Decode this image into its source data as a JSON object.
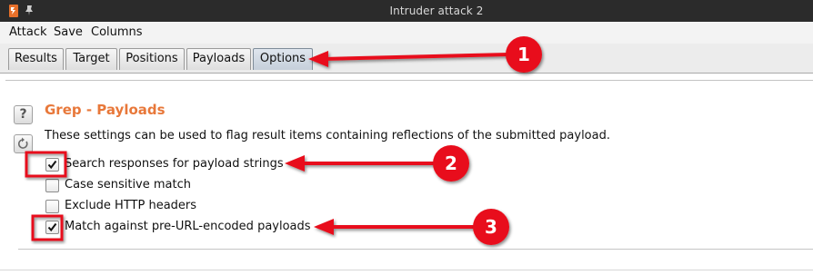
{
  "window": {
    "title": "Intruder attack 2",
    "icons": [
      "burp-logo-icon",
      "pin-icon"
    ]
  },
  "menu": {
    "items": [
      "Attack",
      "Save",
      "Columns"
    ]
  },
  "tabs": {
    "items": [
      "Results",
      "Target",
      "Positions",
      "Payloads",
      "Options"
    ],
    "selected": "Options"
  },
  "section": {
    "title": "Grep - Payloads",
    "description": "These settings can be used to flag result items containing reflections of the submitted payload.",
    "help_icon": "?",
    "options": [
      {
        "label": "Search responses for payload strings",
        "checked": true
      },
      {
        "label": "Case sensitive match",
        "checked": false
      },
      {
        "label": "Exclude HTTP headers",
        "checked": false
      },
      {
        "label": "Match against pre-URL-encoded payloads",
        "checked": true
      }
    ]
  },
  "annotations": {
    "color": "#e8111a",
    "markers": [
      "1",
      "2",
      "3"
    ]
  },
  "colors": {
    "titlebar": "#2b2b2b",
    "section_title": "#e8783a",
    "active_tab": "#c5cfda"
  }
}
